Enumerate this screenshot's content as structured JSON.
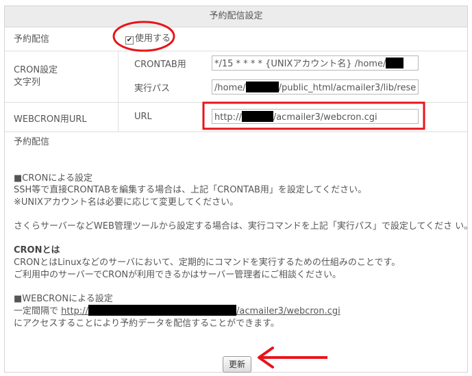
{
  "panel": {
    "title": "予約配信設定",
    "enable_label": "予約配信",
    "enable_checkbox_label": "使用する",
    "enable_checked": true,
    "cron_label_line1": "CRON設定",
    "cron_label_line2": "文字列",
    "crontab_label": "CRONTAB用",
    "crontab_value": "*/15 * * * *  {UNIXアカウント名} /home/",
    "exec_path_label": "実行パス",
    "exec_path_prefix": "/home/",
    "exec_path_suffix": "/public_html/acmailer3/lib/rese",
    "webcron_label": "WEBCRON用URL",
    "url_label": "URL",
    "url_prefix": "http://",
    "url_suffix": "/acmailer3/webcron.cgi"
  },
  "info": {
    "heading": "予約配信",
    "cron_section_title": "■CRONによる設定",
    "cron_line1": "SSH等で直接CRONTABを編集する場合は、上記「CRONTAB用」を設定してください。",
    "cron_line2": "※UNIXアカウント名は必要に応じて変更してください。",
    "server_line": "さくらサーバーなどWEB管理ツールから設定する場合は、実行コマンドを上記「実行パス」で設定してくださ い。",
    "what_is_cron_title": "CRONとは",
    "what_is_cron_line1": "CRONとはLinuxなどのサーバにおいて、定期的にコマンドを実行するための仕組みのことです。",
    "what_is_cron_line2": "ご利用中のサーバーでCRONが利用できるかはサーバー管理者にご相談ください。",
    "webcron_section_title": "■WEBCRONによる設定",
    "webcron_line1_prefix": "一定間隔で",
    "webcron_link_prefix": "http://",
    "webcron_link_suffix": "/acmailer3/webcron.cgi",
    "webcron_line2": "にアクセスすることにより予約データを配信することができます。"
  },
  "update_button": "更新",
  "annotation_color": "#e8141b"
}
